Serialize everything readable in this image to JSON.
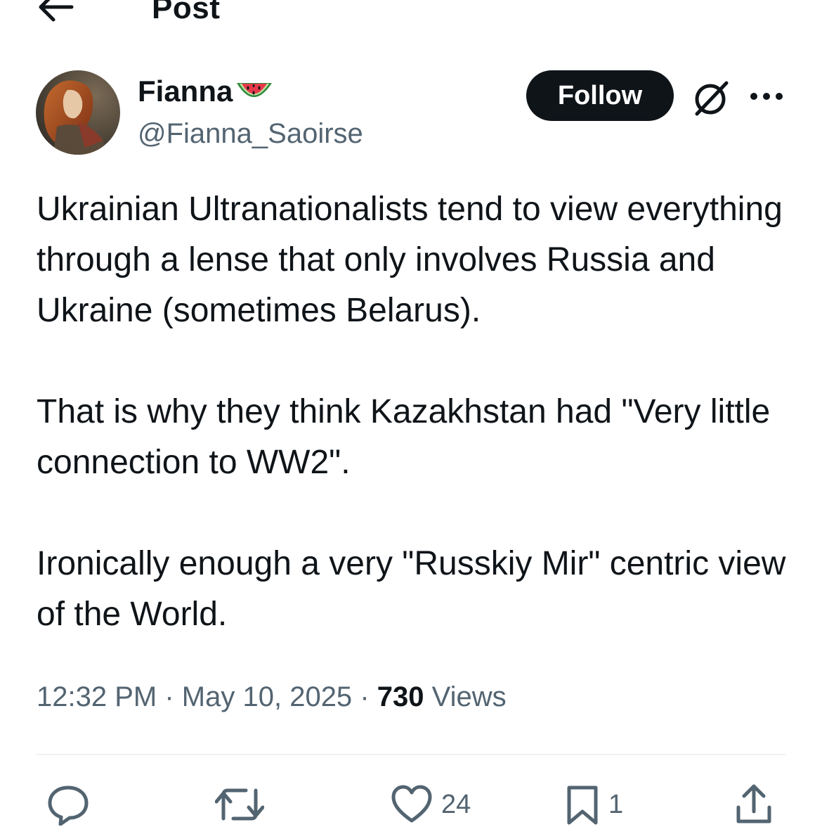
{
  "header": {
    "title": "Post",
    "back_icon": "arrow-left-icon"
  },
  "author": {
    "display_name": "Fianna",
    "name_emoji": "watermelon-icon",
    "handle": "@Fianna_Saoirse",
    "avatar": "avatar-painting"
  },
  "actions_top": {
    "follow_label": "Follow",
    "grok_icon": "grok-icon",
    "more_icon": "more-horizontal-icon"
  },
  "post": {
    "paragraphs": [
      "Ukrainian Ultranationalists tend to view everything through a lense that only involves Russia and Ukraine (sometimes Belarus).",
      "That is why they think Kazakhstan had \"Very little connection to WW2\".",
      "Ironically enough a very \"Russkiy Mir\" centric view of the World."
    ]
  },
  "meta": {
    "time": "12:32 PM",
    "separator": "·",
    "date": "May 10, 2025",
    "views_count": "730",
    "views_label": "Views"
  },
  "action_bar": {
    "reply": {
      "icon": "reply-icon",
      "count": ""
    },
    "repost": {
      "icon": "repost-icon",
      "count": ""
    },
    "like": {
      "icon": "heart-icon",
      "count": "24"
    },
    "bookmark": {
      "icon": "bookmark-icon",
      "count": "1"
    },
    "share": {
      "icon": "share-icon",
      "count": ""
    }
  },
  "colors": {
    "text": "#0f1419",
    "secondary": "#536471",
    "divider": "#eff3f4",
    "follow_bg": "#0f1419"
  }
}
